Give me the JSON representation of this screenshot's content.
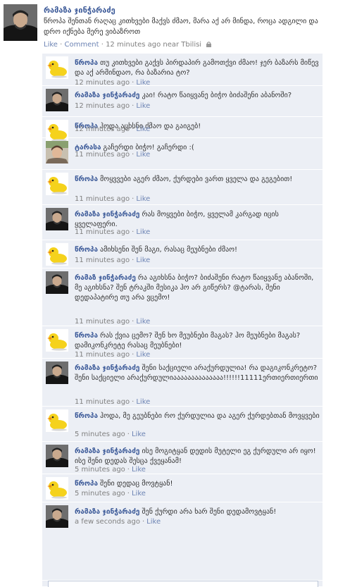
{
  "post": {
    "author": "რამაზა ჯინჭარაძე",
    "text": "წროპა შენთან რაღაც კითხვები მაქვს ძმაო, მარა აქ არ მინდა, როცა ადგილი და დრო იქნება მერე ვიბაზროთ",
    "like_label": "Like",
    "comment_label": "Comment",
    "timestamp": "12 minutes ago near Tbilisi",
    "separator": "·"
  },
  "comments": [
    {
      "author": "წროპა",
      "text": "თუ კითხვები გაქვს პირდაპირ გამოთქვი ძმაო! ჯერ ბაზარს მიწევ და აქ არმინდაო, რა ბაზარია ტო?",
      "time": "12 minutes ago",
      "like": "Like",
      "avatar": "duck"
    },
    {
      "author": "რამაზა ჯინჭარაძე",
      "text": "კაი! რატო წაიყვანე ბიჭო ბიძაშენი აბანოში?",
      "time": "12 minutes ago",
      "like": "Like",
      "avatar": "person"
    },
    {
      "author": "წროპა",
      "text": "ჰოდა აცხსნი ძმაო და გაიგებ!",
      "time": "12 minutes ago",
      "like": "Like",
      "avatar": "duck"
    },
    {
      "author": "ტარასა",
      "text": "გაჩერდი ბიჭო! გაჩერდი :(",
      "time": "11 minutes ago",
      "like": "Like",
      "avatar": "tarasa"
    },
    {
      "author": "წროპა",
      "text": "მოყვვები აგერ ძმაო, ქურდები ვართ ყველა და გეგებით!",
      "time": "11 minutes ago",
      "like": "Like",
      "avatar": "duck"
    },
    {
      "author": "რამაზა ჯინჭარაძე",
      "text": "რას მოყვები ბიჭო, ყველამ კარგად იცის ყველაფერი.",
      "time": "11 minutes ago",
      "like": "Like",
      "avatar": "person"
    },
    {
      "author": "წროპა",
      "text": "ამიხსენი შენ მაგი, რასაც მეუბნები ძმაო!",
      "time": "11 minutes ago",
      "like": "Like",
      "avatar": "duck"
    },
    {
      "author": "რამაზ ჯინჭარაძე",
      "text": "რა აგიხსნა ბიჭო? ბიძაშენი რატო წაიყვანე აბანოში, მე აგიხსნა? შენ ტრაკში მესიკა ჰო არ გიწერს? @ტარას, შენი დედაპატირე თუ არა ვცემო!",
      "time": "11 minutes ago",
      "like": "Like",
      "avatar": "person"
    },
    {
      "author": "წროპა",
      "text": "რას ქვია ცემო? შენ ხო მეუბნები მაგას? ჰო მეუბნები მაგას? დამიკონკრეტე რასაც მეუბნები!",
      "time": "11 minutes ago",
      "like": "Like",
      "avatar": "duck"
    },
    {
      "author": "რამაზა ჯინჭარაძე",
      "text": "შენი საქციელი არაქურდულია! რა დაგიკონკრეტო? შენი საქციელი არაქურდულიაააააააააააააა!!!!!!11111ერთიერთიერთი",
      "time": "11 minutes ago",
      "like": "Like",
      "avatar": "person"
    },
    {
      "author": "წროპა",
      "text": "ჰოდა, მე გეუბნები რო ქურდულია და აგერ ქურდებთან მოვყვები",
      "time": "5 minutes ago",
      "like": "Like",
      "avatar": "duck"
    },
    {
      "author": "რამაზა ჯინჭარაძე",
      "text": "ისე მოგიტყან დედის მუტელი ეგ ქურდული არ იყო! ისე შენი დედას შესცა ქვეყანამ!",
      "time": "5 minutes ago",
      "like": "Like",
      "avatar": "person"
    },
    {
      "author": "წროპა",
      "text": "შენი დედაც მოვტყან!",
      "time": "5 minutes ago",
      "like": "Like",
      "avatar": "duck"
    },
    {
      "author": "რამაზა ჯინჭარაძე",
      "text": "შენ ქურდი არა ხარ შენი დედამოვტყან!",
      "time": "a few seconds ago",
      "like": "Like",
      "avatar": "person"
    }
  ]
}
